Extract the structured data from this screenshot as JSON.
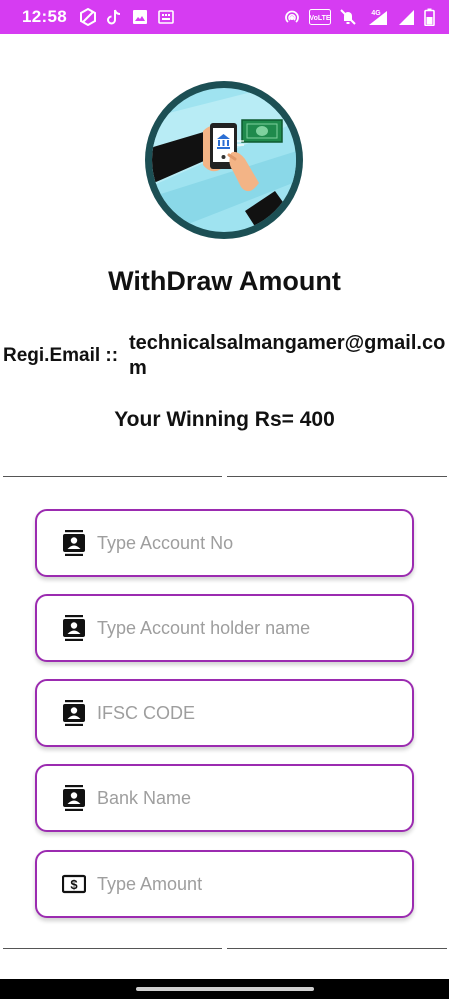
{
  "status_bar": {
    "time": "12:58",
    "background": "#d63cf2",
    "left_icons": [
      "vpn-icon",
      "tiktok-icon",
      "image-icon",
      "keyboard-icon"
    ],
    "right_icons": [
      "hotspot-icon",
      "volte-icon",
      "mute-icon",
      "signal-4g-icon",
      "signal-icon",
      "battery-icon"
    ],
    "volte_text": "VoLTE",
    "network_text": "4G"
  },
  "hero": {
    "icon": "mobile-banking-withdraw-illustration"
  },
  "title": "WithDraw Amount",
  "registration": {
    "label": "Regi.Email ::",
    "email": "technicalsalmangamer@gmail.com"
  },
  "winning_text": "Your Winning Rs= 400",
  "form": {
    "fields": [
      {
        "name": "account-number-input",
        "placeholder": "Type Account No",
        "value": "",
        "icon": "contact-card-icon"
      },
      {
        "name": "account-holder-input",
        "placeholder": "Type Account holder name",
        "value": "",
        "icon": "contact-card-icon"
      },
      {
        "name": "ifsc-code-input",
        "placeholder": "IFSC CODE",
        "value": "",
        "icon": "contact-card-icon"
      },
      {
        "name": "bank-name-input",
        "placeholder": "Bank Name",
        "value": "",
        "icon": "contact-card-icon"
      },
      {
        "name": "amount-input",
        "placeholder": "Type Amount",
        "value": "",
        "icon": "dollar-bill-icon"
      }
    ],
    "border_color": "#9b2bb0"
  }
}
